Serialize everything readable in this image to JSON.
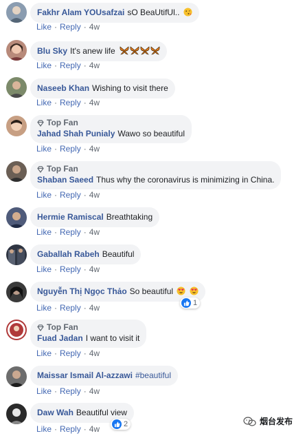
{
  "actions": {
    "like": "Like",
    "reply": "Reply",
    "separator": "·"
  },
  "top_fan_label": "Top Fan",
  "comments": [
    {
      "author": "Fakhr Alam YOUsafzai",
      "text": "sO BeaUtifUl..",
      "emoji": "kissing-face",
      "time": "4w",
      "avatar_color": "#8a9cb0"
    },
    {
      "author": "Blu Sky",
      "text": "It's anew life",
      "emoji": "butterflies",
      "time": "4w",
      "avatar_color": "#b88a7a"
    },
    {
      "author": "Naseeb Khan",
      "text": "Wishing to visit there",
      "time": "4w",
      "avatar_color": "#7c8a6a"
    },
    {
      "author": "Jahad Shah Punialy",
      "text": "Wawo so beautiful",
      "time": "4w",
      "top_fan": true,
      "avatar_color": "#c79f83"
    },
    {
      "author": "Shaban Saeed",
      "text": "Thus why the coronavirus is minimizing in China.",
      "time": "4w",
      "top_fan": true,
      "avatar_color": "#6b5f55"
    },
    {
      "author": "Hermie Ramiscal",
      "text": "Breathtaking",
      "time": "4w",
      "avatar_color": "#4f5b7a"
    },
    {
      "author": "Gaballah Rabeh",
      "text": "Beautiful",
      "time": "4w",
      "avatar_color": "#2f3542"
    },
    {
      "author": "Nguyễn Thị Ngọc Thảo",
      "text": "So beautiful",
      "emoji": "heart-eyes",
      "time": "4w",
      "reactions": "1",
      "avatar_color": "#3a3a3a"
    },
    {
      "author": "Fuad Jadan",
      "text": "I want to visit it",
      "time": "4w",
      "top_fan": true,
      "avatar_color": "#b03a3a"
    },
    {
      "author": "Maissar Ismail Al-azzawi",
      "text": "#beautiful",
      "time": "4w",
      "avatar_color": "#6d6d6d"
    },
    {
      "author": "Daw Wah",
      "text": "Beautiful view",
      "time": "4w",
      "reactions": "2",
      "avatar_color": "#2a2a2a"
    }
  ],
  "watermark": {
    "text": "烟台发布"
  }
}
